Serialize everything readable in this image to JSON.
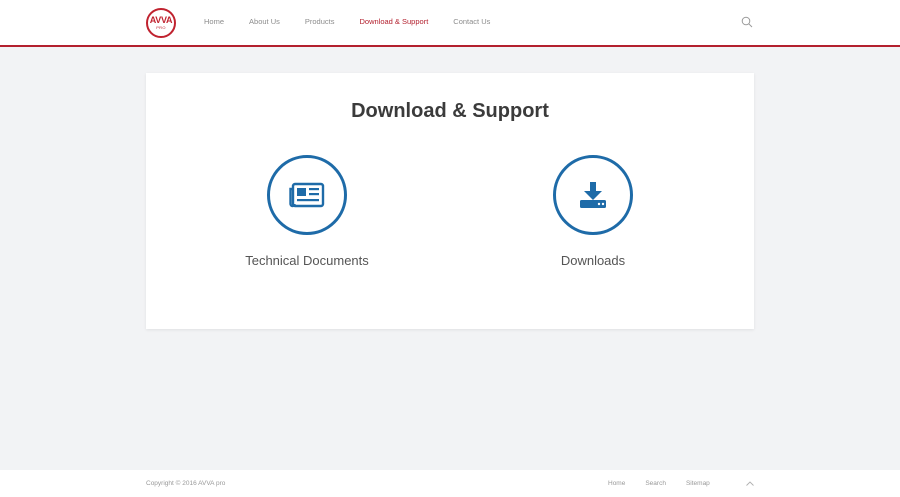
{
  "header": {
    "logo": {
      "main": "AVVA",
      "sub": "PRO"
    },
    "nav": [
      {
        "label": "Home",
        "active": false
      },
      {
        "label": "About Us",
        "active": false
      },
      {
        "label": "Products",
        "active": false
      },
      {
        "label": "Download & Support",
        "active": true
      },
      {
        "label": "Contact Us",
        "active": false
      }
    ]
  },
  "main": {
    "title": "Download & Support",
    "tiles": [
      {
        "label": "Technical Documents",
        "icon": "newspaper-icon"
      },
      {
        "label": "Downloads",
        "icon": "download-icon"
      }
    ]
  },
  "footer": {
    "copyright": "Copyright © 2016 AVVA pro",
    "links": [
      "Home",
      "Search",
      "Sitemap"
    ]
  },
  "colors": {
    "brand": "#b3202e",
    "accent": "#1e6ba8",
    "background": "#f2f3f5"
  }
}
